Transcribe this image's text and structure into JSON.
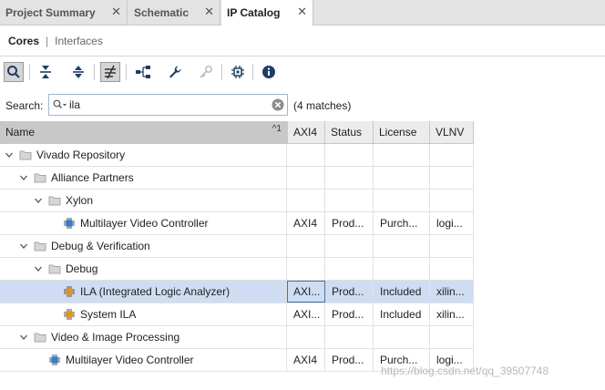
{
  "tabs": [
    {
      "label": "Project Summary"
    },
    {
      "label": "Schematic"
    },
    {
      "label": "IP Catalog"
    }
  ],
  "view": {
    "cores": "Cores",
    "separator": "|",
    "interfaces": "Interfaces"
  },
  "search": {
    "label": "Search:",
    "value": "ila",
    "matches": "(4 matches)"
  },
  "table": {
    "columns": {
      "name": "Name",
      "sort": "^1",
      "axi4": "AXI4",
      "status": "Status",
      "license": "License",
      "vlnv": "VLNV"
    },
    "rows": [
      {
        "name": "Vivado Repository",
        "axi4": "",
        "status": "",
        "license": "",
        "vlnv": ""
      },
      {
        "name": "Alliance Partners",
        "axi4": "",
        "status": "",
        "license": "",
        "vlnv": ""
      },
      {
        "name": "Xylon",
        "axi4": "",
        "status": "",
        "license": "",
        "vlnv": ""
      },
      {
        "name": "Multilayer Video Controller",
        "axi4": "AXI4",
        "status": "Prod...",
        "license": "Purch...",
        "vlnv": "logi..."
      },
      {
        "name": "Debug & Verification",
        "axi4": "",
        "status": "",
        "license": "",
        "vlnv": ""
      },
      {
        "name": "Debug",
        "axi4": "",
        "status": "",
        "license": "",
        "vlnv": ""
      },
      {
        "name": "ILA (Integrated Logic Analyzer)",
        "axi4": "AXI...",
        "status": "Prod...",
        "license": "Included",
        "vlnv": "xilin..."
      },
      {
        "name": "System ILA",
        "axi4": "AXI...",
        "status": "Prod...",
        "license": "Included",
        "vlnv": "xilin..."
      },
      {
        "name": "Video & Image Processing",
        "axi4": "",
        "status": "",
        "license": "",
        "vlnv": ""
      },
      {
        "name": "Multilayer Video Controller",
        "axi4": "AXI4",
        "status": "Prod...",
        "license": "Purch...",
        "vlnv": "logi..."
      }
    ]
  },
  "toolbar_icons": [
    "search-icon",
    "collapse-all-icon",
    "expand-all-icon",
    "filter-toggle-icon",
    "hierarchy-icon",
    "wrench-icon",
    "key-icon",
    "chip-icon",
    "info-icon"
  ],
  "colors": {
    "selection": "#cfddf3",
    "ip_icon_blue": "#2e7fd0",
    "ip_icon_orange": "#e8921e",
    "folder": "#a7a7a7"
  },
  "watermark": "https://blog.csdn.net/qq_39507748"
}
